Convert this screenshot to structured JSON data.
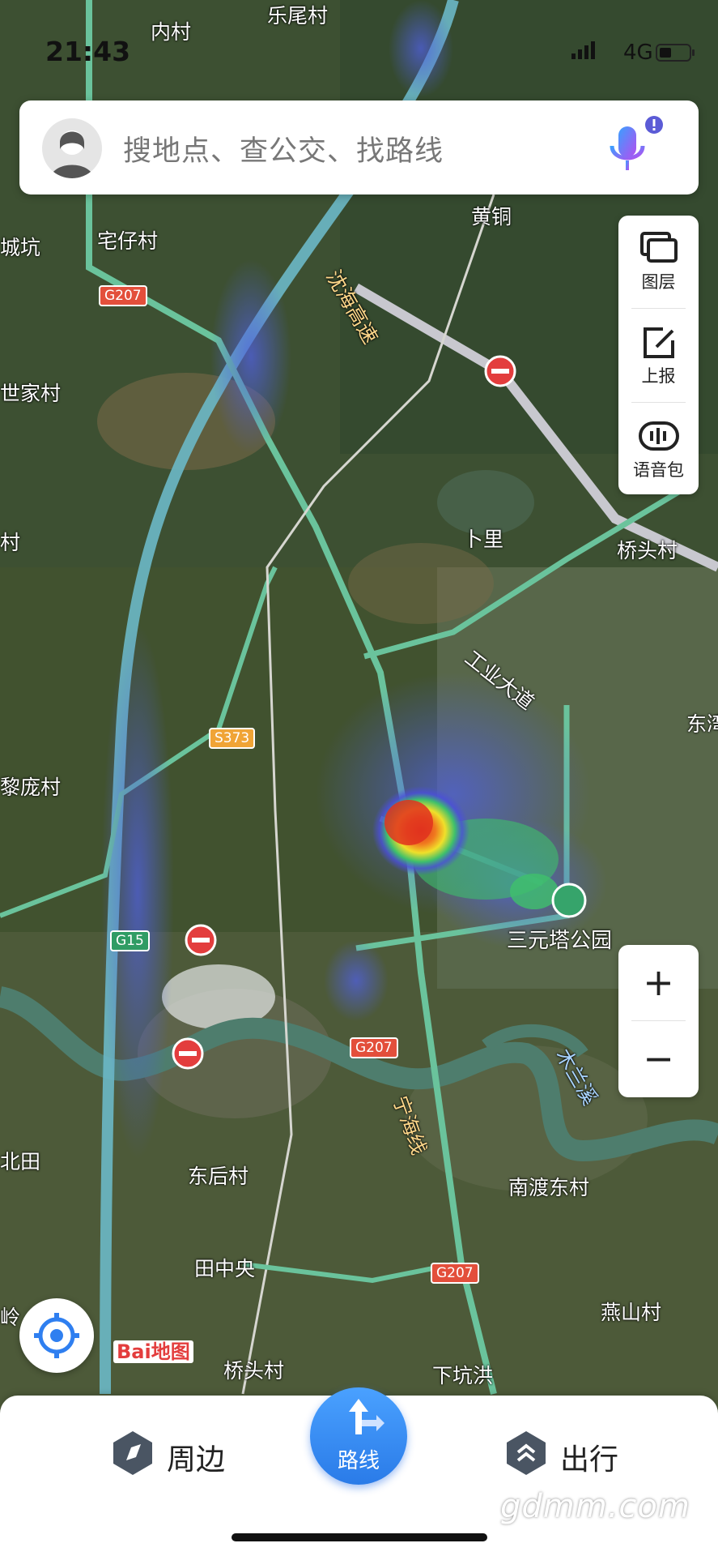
{
  "status_bar": {
    "time": "21:43",
    "network": "4G"
  },
  "search": {
    "placeholder": "搜地点、查公交、找路线"
  },
  "side_panel": {
    "layers": "图层",
    "report": "上报",
    "voice_pack": "语音包"
  },
  "zoom": {
    "in": "+",
    "out": "−"
  },
  "map_labels": {
    "neicun": "内村",
    "leweicun": "乐尾村",
    "zhaicun": "宅仔村",
    "huangtong": "黄铜",
    "cheng_keng": "城坑",
    "shijiacun": "世家村",
    "buli": "卜里",
    "qiaotoucun": "桥头村",
    "gongye": "工业大道",
    "dongzhen": "东湾",
    "lipangcun": "黎庞村",
    "sanyuanta": "三元塔公园",
    "beitian": "北田",
    "donghoucun": "东后村",
    "nanducun": "南渡东村",
    "tianzhongyang": "田中央",
    "xiakenghong": "下坑洪",
    "yanshancun": "燕山村",
    "qiaotoucun2": "桥头村",
    "ling": "岭",
    "cun_left": "村",
    "shenhai": "沈海高速",
    "ninghai": "宁海线",
    "river": "木兰溪"
  },
  "road_shields": {
    "g207_a": "G207",
    "s373": "S373",
    "g15": "G15",
    "g207_b": "G207",
    "g207_c": "G207"
  },
  "brand": {
    "logo": "Bai地图"
  },
  "bottom_nav": {
    "nearby": "周边",
    "route": "路线",
    "travel": "出行"
  },
  "watermark": "gdmm.com",
  "colors": {
    "accent": "#2f7ff0",
    "heat_hot": "#e5351e",
    "heat_warm": "#f5e02c",
    "heat_cool": "#3ec06b",
    "heat_cold": "#4a4ad6"
  }
}
